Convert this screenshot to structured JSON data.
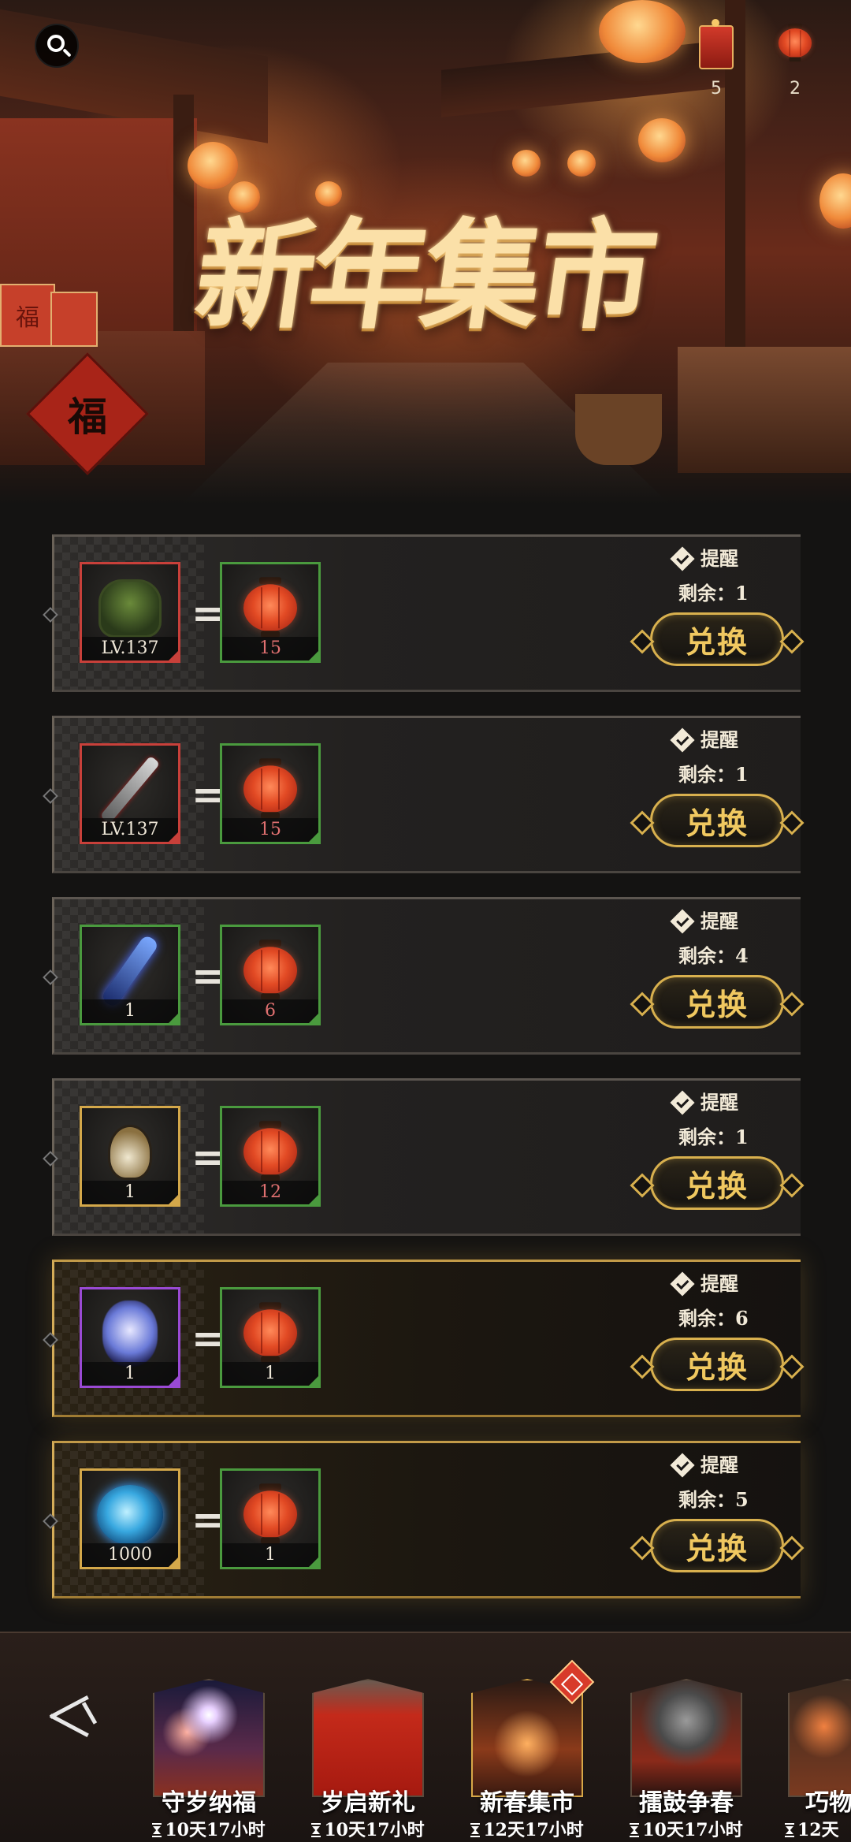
{
  "banner": {
    "title": "新年集市",
    "fu_char": "福"
  },
  "resources": [
    {
      "icon": "firecracker-icon",
      "count": "5"
    },
    {
      "icon": "lantern-icon",
      "count": "2"
    }
  ],
  "labels": {
    "remind": "提醒",
    "remaining_prefix": "剩余：",
    "exchange": "兑换",
    "equals": "="
  },
  "rows": [
    {
      "item": "armor-icon",
      "item_label": "LV.137",
      "item_quality": "red",
      "cost": "15",
      "cost_affordable": false,
      "remaining": "1",
      "highlight": false
    },
    {
      "item": "sword-icon",
      "item_label": "LV.137",
      "item_quality": "red",
      "cost": "15",
      "cost_affordable": false,
      "remaining": "1",
      "highlight": false
    },
    {
      "item": "blue-blade-icon",
      "item_label": "1",
      "item_quality": "green",
      "cost": "6",
      "cost_affordable": false,
      "remaining": "4",
      "highlight": false
    },
    {
      "item": "flask-icon",
      "item_label": "1",
      "item_quality": "gold",
      "cost": "12",
      "cost_affordable": false,
      "remaining": "1",
      "highlight": false
    },
    {
      "item": "spirit-icon",
      "item_label": "1",
      "item_quality": "purple",
      "cost": "1",
      "cost_affordable": true,
      "remaining": "6",
      "highlight": true
    },
    {
      "item": "orb-icon",
      "item_label": "1000",
      "item_quality": "gold",
      "cost": "1",
      "cost_affordable": true,
      "remaining": "5",
      "highlight": true
    }
  ],
  "bottom_nav": {
    "events": [
      {
        "name": "守岁纳福",
        "timer": "10天17小时",
        "active": false
      },
      {
        "name": "岁启新礼",
        "timer": "10天17小时",
        "active": false
      },
      {
        "name": "新春集市",
        "timer": "12天17小时",
        "active": true
      },
      {
        "name": "擂鼓争春",
        "timer": "10天17小时",
        "active": false
      },
      {
        "name": "巧物",
        "timer": "12天",
        "active": false
      }
    ]
  },
  "colors": {
    "accent_gold": "#d8b04e",
    "cost_insufficient": "#e07070",
    "quality_red": "#c8403a",
    "quality_green": "#4a9a3e",
    "quality_gold": "#d4a84a",
    "quality_purple": "#9a4ad4"
  }
}
